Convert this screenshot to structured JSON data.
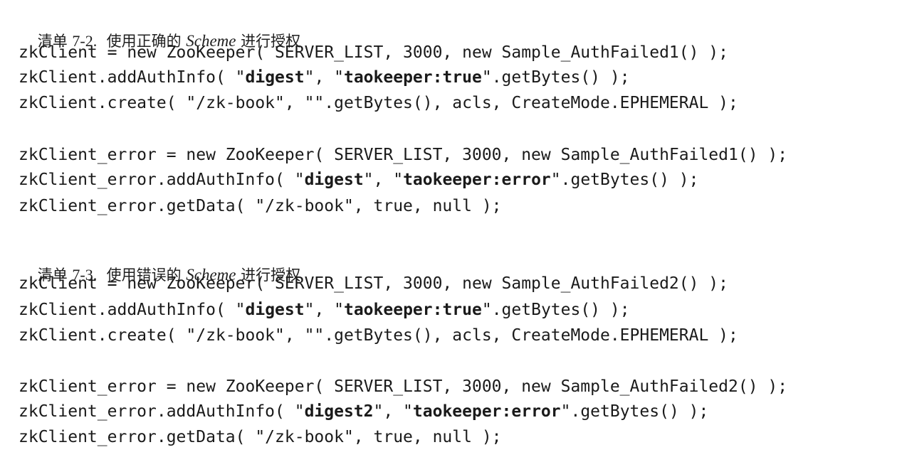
{
  "listings": [
    {
      "caption": {
        "prefix": "清单 ",
        "number": "7-2.",
        "middle": "  使用正确的 ",
        "scheme": "Scheme",
        "suffix": " 进行授权"
      },
      "lines": [
        {
          "segments": [
            {
              "text": "zkClient = new ZooKeeper( SERVER_LIST, 3000, new Sample_AuthFailed1() );"
            }
          ]
        },
        {
          "segments": [
            {
              "text": "zkClient.addAuthInfo( \""
            },
            {
              "text": "digest",
              "bold": true
            },
            {
              "text": "\", \""
            },
            {
              "text": "taokeeper:true",
              "bold": true
            },
            {
              "text": "\".getBytes() );"
            }
          ]
        },
        {
          "segments": [
            {
              "text": "zkClient.create( \"/zk-book\", \"\".getBytes(), acls, CreateMode.EPHEMERAL );"
            }
          ]
        },
        {
          "segments": [
            {
              "text": "zkClient_error = new ZooKeeper( SERVER_LIST, 3000, new Sample_AuthFailed1() );"
            }
          ]
        },
        {
          "segments": [
            {
              "text": "zkClient_error.addAuthInfo( \""
            },
            {
              "text": "digest",
              "bold": true
            },
            {
              "text": "\", \""
            },
            {
              "text": "taokeeper:error",
              "bold": true
            },
            {
              "text": "\".getBytes() );"
            }
          ]
        },
        {
          "segments": [
            {
              "text": "zkClient_error.getData( \"/zk-book\", true, null );"
            }
          ]
        }
      ]
    },
    {
      "caption": {
        "prefix": "清单 ",
        "number": "7-3.",
        "middle": "  使用错误的 ",
        "scheme": "Scheme",
        "suffix": " 进行授权"
      },
      "lines": [
        {
          "segments": [
            {
              "text": "zkClient = new ZooKeeper( SERVER_LIST, 3000, new Sample_AuthFailed2() );"
            }
          ]
        },
        {
          "segments": [
            {
              "text": "zkClient.addAuthInfo( \""
            },
            {
              "text": "digest",
              "bold": true
            },
            {
              "text": "\", \""
            },
            {
              "text": "taokeeper:true",
              "bold": true
            },
            {
              "text": "\".getBytes() );"
            }
          ]
        },
        {
          "segments": [
            {
              "text": "zkClient.create( \"/zk-book\", \"\".getBytes(), acls, CreateMode.EPHEMERAL );"
            }
          ]
        },
        {
          "segments": [
            {
              "text": "zkClient_error = new ZooKeeper( SERVER_LIST, 3000, new Sample_AuthFailed2() );"
            }
          ]
        },
        {
          "segments": [
            {
              "text": "zkClient_error.addAuthInfo( \""
            },
            {
              "text": "digest2",
              "bold": true
            },
            {
              "text": "\", \""
            },
            {
              "text": "taokeeper:error",
              "bold": true
            },
            {
              "text": "\".getBytes() );"
            }
          ]
        },
        {
          "segments": [
            {
              "text": "zkClient_error.getData( \"/zk-book\", true, null );"
            }
          ]
        }
      ]
    }
  ]
}
